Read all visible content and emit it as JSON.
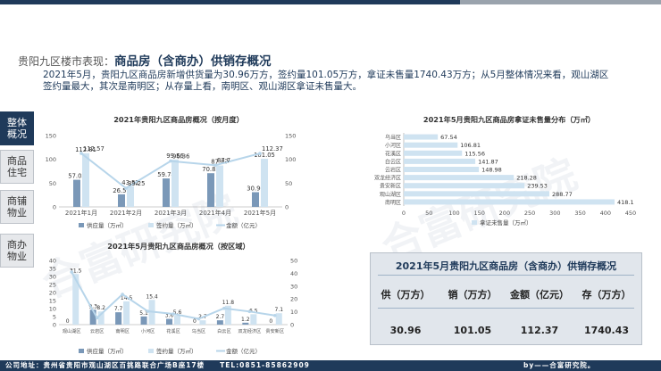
{
  "header": {
    "title_prefix": "贵阳九区楼市表现：",
    "title_main": "商品房（含商办）供销存概况"
  },
  "summary": "2021年5月，贵阳九区商品房新增供货量为30.96万方，签约量101.05万方，拿证未售量1740.43万方；从5月整体情况来看，观山湖区签约量最大，其次是南明区；从存量上看，南明区、观山湖区拿证未售量大。",
  "sidebar": {
    "tabs": [
      {
        "label": "整体概况",
        "active": true
      },
      {
        "label": "商品住宅",
        "active": false
      },
      {
        "label": "商铺物业",
        "active": false
      },
      {
        "label": "商办物业",
        "active": false
      }
    ]
  },
  "watermark": "合富研究院",
  "chart_data": [
    {
      "type": "bar+line",
      "title": "2021年贵阳九区商品房概况（按月度）",
      "categories": [
        "2021年1月",
        "2021年2月",
        "2021年3月",
        "2021年4月",
        "2021年5月"
      ],
      "series": [
        {
          "name": "供应量（万㎡）",
          "kind": "bar",
          "values": [
            57.03,
            26.51,
            59.78,
            70.85,
            30.96
          ]
        },
        {
          "name": "签约量（万㎡）",
          "kind": "bar",
          "values": [
            112.81,
            43.52,
            99.56,
            87.07,
            101.05
          ]
        },
        {
          "name": "金额（亿元）",
          "kind": "line",
          "axis": "right",
          "values": [
            112.57,
            39.25,
            96.36,
            87.7,
            112.37
          ]
        }
      ],
      "yticks": [
        0,
        50,
        100,
        150
      ],
      "ylim": [
        0,
        150
      ],
      "yticks_right": [
        0,
        50,
        100,
        150
      ],
      "ylim_right": [
        0,
        150
      ],
      "legend": "bottom"
    },
    {
      "type": "bar",
      "title": "2021年5月贵阳九区商品房拿证未售量分布（万㎡）",
      "categories": [
        "乌当区",
        "小河区",
        "花溪区",
        "白云区",
        "云岩区",
        "双龙经济区",
        "贵安新区",
        "观山湖区",
        "南明区"
      ],
      "values": [
        67.54,
        106.81,
        115.56,
        141.87,
        148.98,
        218.28,
        239.53,
        288.77,
        418.1
      ],
      "xticks": [
        0,
        50,
        100,
        150,
        200,
        250,
        300,
        350,
        400,
        450
      ],
      "xlim": [
        0,
        450
      ],
      "legend": "bottom",
      "legend_label": "拿证未售量（万㎡）"
    },
    {
      "type": "bar+line",
      "title": "2021年5月贵阳九区商品房概况（按区域）",
      "categories": [
        "观山湖区",
        "云岩区",
        "南明区",
        "小河区",
        "花溪区",
        "乌当区",
        "白云区",
        "双龙经济区",
        "贵安新区"
      ],
      "series": [
        {
          "name": "供应量（万㎡）",
          "kind": "bar",
          "values": [
            0,
            9.3,
            7.7,
            5.1,
            3.6,
            0,
            2.7,
            1.2,
            0
          ]
        },
        {
          "name": "签约量（万㎡）",
          "kind": "bar",
          "values": [
            31.5,
            8.2,
            14.5,
            15.4,
            5.6,
            2.7,
            11.8,
            6.5,
            7.1
          ]
        },
        {
          "name": "金额（亿元）",
          "kind": "line",
          "axis": "right",
          "values": [
            40.9,
            5.3,
            23.6,
            10.4,
            8.3,
            4.5,
            12.7,
            10.2,
            7.1
          ]
        }
      ],
      "yticks": [
        0,
        5,
        10,
        15,
        20,
        25,
        30,
        35,
        40
      ],
      "ylim": [
        0,
        40
      ],
      "yticks_right": [
        0,
        10,
        20,
        30,
        40,
        50
      ],
      "ylim_right": [
        0,
        50
      ],
      "legend": "bottom"
    }
  ],
  "table": {
    "title": "2021年5月贵阳九区商品房（含商办）供销存概况",
    "headers": [
      "供（万方）",
      "销（万方）",
      "金额（亿元）",
      "存（万方）"
    ],
    "values": [
      "30.96",
      "101.05",
      "112.37",
      "1740.43"
    ]
  },
  "footer": {
    "address": "公司地址：贵州省贵阳市观山湖区百挑路联合广场B座17楼　　TEL:0851-85862909",
    "by": "by——合富研究院。"
  },
  "colors": {
    "navy": "#1f3a5a",
    "bar_supply": "#7a98b8",
    "bar_sign": "#cfe3f1",
    "line_amount": "#b7d5ea"
  }
}
